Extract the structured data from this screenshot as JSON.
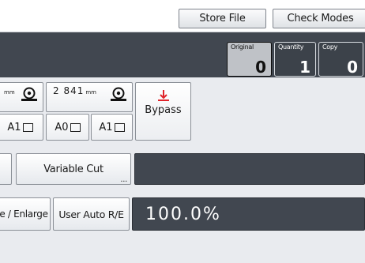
{
  "header": {
    "store_file_label": "Store File",
    "check_modes_label": "Check Modes"
  },
  "counters": {
    "original": {
      "label": "Original",
      "value": "0"
    },
    "quantity": {
      "label": "Quantity",
      "value": "1"
    },
    "copy": {
      "label": "Copy",
      "value": "0"
    }
  },
  "trays": {
    "tray1_unit": "mm",
    "tray2_width": "2 841",
    "tray2_unit": "mm",
    "size1_label": "A1",
    "size2_label": "A0",
    "size3_label": "A1"
  },
  "bypass": {
    "label": "Bypass"
  },
  "cut": {
    "variable_cut_label": "Variable Cut"
  },
  "reproduction": {
    "reduce_enlarge_label": "e / Enlarge",
    "user_auto_label": "User Auto R/E",
    "ratio_value": "100.0%"
  },
  "colors": {
    "dark_panel": "#414750",
    "bypass_icon": "#e0242a"
  },
  "icons": {
    "roll": "paper-roll-icon",
    "bypass": "bypass-arrow-icon",
    "paper": "paper-orientation-icon"
  }
}
